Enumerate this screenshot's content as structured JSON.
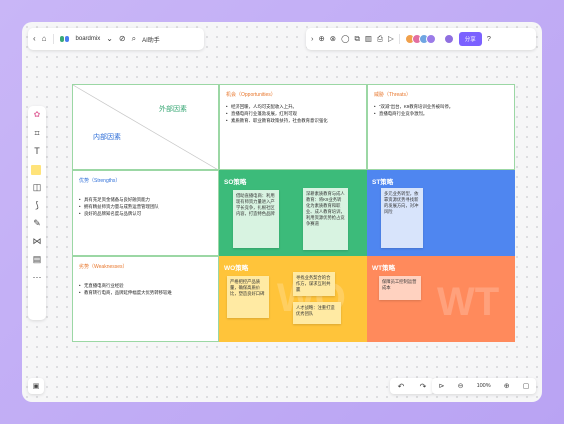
{
  "app": {
    "brand": "boardmix",
    "ai_label": "AI助手",
    "ai_prefix": "AI",
    "share_label": "分享"
  },
  "icons": {
    "back": "‹",
    "home": "⌂",
    "chevron": "⌄",
    "tag": "⊘",
    "search": "⌕",
    "pointer": "›",
    "add": "⊕",
    "grid": "⊗",
    "chat": "◯",
    "frame": "⧉",
    "chart": "▥",
    "template": "⎙",
    "play": "▷",
    "help": "?",
    "undo": "↶",
    "redo": "↷",
    "select": "⊳",
    "zoom_out": "⊖",
    "zoom_in": "⊕",
    "minimap": "▢",
    "layers": "▣"
  },
  "colors": {
    "accent": "#7b61ff",
    "so": "#3cbb7a",
    "st": "#4f86f0",
    "wo": "#ffc43a",
    "wt": "#ff8a5c",
    "border": "#9bd7a4"
  },
  "avatars": [
    "#f0a04b",
    "#e26fa0",
    "#6fa5e2",
    "#9b7be8"
  ],
  "user_avatar": "#8f6fe0",
  "zoom": "100%",
  "matrix": {
    "outer_factor": "外部因素",
    "inner_factor": "内部因素",
    "opportunities": {
      "title": "机会（Opportunities）",
      "items": [
        "经济回暖，人均可支配收入上升。",
        "直播电商行业蓬勃发展，红利可观",
        "素质教育、职业教育政策扶持，社会教育意识强化"
      ]
    },
    "threats": {
      "title": "威胁（Threats）",
      "items": [
        "“双减”出台，K9教育培训业务被叫停。",
        "直播电商行业竞争激烈。"
      ]
    },
    "strengths": {
      "title": "优势（Strengths）",
      "items": [
        "具有充足资金储备与良好融资能力",
        "拥有精益师资力量与成熟运营管理团队",
        "良好的品牌知名度与品牌认可"
      ]
    },
    "weaknesses": {
      "title": "劣势（Weaknesses）",
      "items": [
        "无直播电商行业经验",
        "教育转行电商，品牌延伸幅度大优势转移较难"
      ]
    },
    "so": {
      "label": "SO策略",
      "notes": [
        "借助直播电商：利用现有师资力量进入产学长竞争，扎根社区内容，打造特色品牌",
        "深耕素质教育与成人教育：将K9业务转化为素质教育和职业、成人教育培训，利用资源优势抢占竞争赛道"
      ]
    },
    "st": {
      "label": "ST策略",
      "notes": [
        "多元业务转型，依靠资源优势寻找新的发展方向，对冲风险"
      ]
    },
    "wo": {
      "label": "WO策略",
      "notes": [
        "严格把控产品质量，确保高质价比，塑造良好口碑",
        "寻找业务契合的合作方，谋求互利共赢",
        "人才战略：注重打造优秀团队"
      ],
      "watermark": "WO"
    },
    "wt": {
      "label": "WT策略",
      "notes": [
        "保障员工控制运营成本"
      ],
      "watermark": "WT"
    }
  }
}
